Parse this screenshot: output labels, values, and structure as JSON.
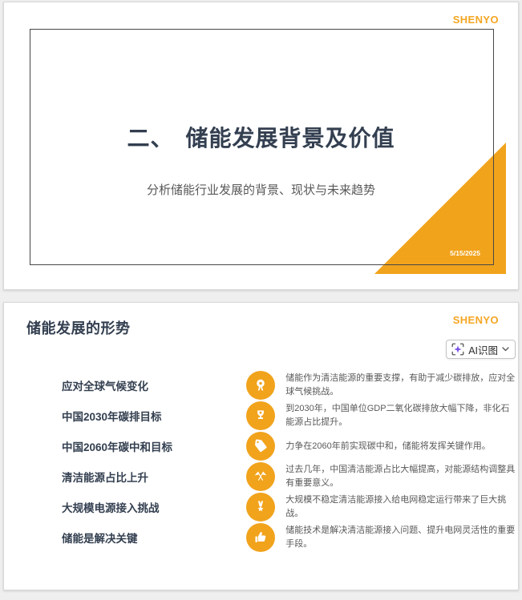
{
  "brand": {
    "logo": "SHENYO",
    "logo_color": "#F5A623"
  },
  "colors": {
    "accent_orange": "#F1A31C",
    "heading_navy": "#333F50",
    "body_gray": "#595959",
    "page_background": "#EFEFEF",
    "sparkle_purple": "#7B52E8"
  },
  "slide1": {
    "title": "二、　储能发展背景及价值",
    "subtitle": "分析储能行业发展的背景、现状与未来趋势",
    "date": "5/15/2025"
  },
  "slide2": {
    "title": "储能发展的形势",
    "ai_button": {
      "label": "AI识图",
      "icon": "scan-sparkle-icon"
    },
    "rows": [
      {
        "label": "应对全球气候变化",
        "icon": "award-ribbon-icon",
        "desc": "储能作为清洁能源的重要支撑，有助于减少碳排放，应对全球气候挑战。"
      },
      {
        "label": "中国2030年碳排目标",
        "icon": "trophy-icon",
        "desc": "到2030年，中国单位GDP二氧化碳排放大幅下降，非化石能源占比提升。"
      },
      {
        "label": "中国2060年碳中和目标",
        "icon": "tag-icon",
        "desc": "力争在2060年前实现碳中和，储能将发挥关键作用。"
      },
      {
        "label": "清洁能源占比上升",
        "icon": "crossed-flags-icon",
        "desc": "过去几年，中国清洁能源占比大幅提高，对能源结构调整具有重要意义。"
      },
      {
        "label": "大规模电源接入挑战",
        "icon": "medal-star-icon",
        "desc": "大规模不稳定清洁能源接入给电网稳定运行带来了巨大挑战。"
      },
      {
        "label": "储能是解决关键",
        "icon": "thumbs-up-icon",
        "desc": "储能技术是解决清洁能源接入问题、提升电网灵活性的重要手段。"
      }
    ]
  }
}
